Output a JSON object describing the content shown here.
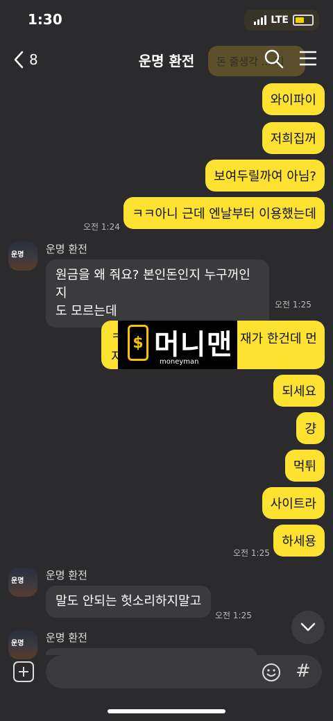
{
  "status_bar": {
    "time": "1:30",
    "network": "LTE"
  },
  "header": {
    "back_count": "8",
    "title": "운명 환전",
    "ghost_text": "돈 줄생각 ... 지"
  },
  "messages": {
    "m1": "와이파이",
    "m2": "저희집꺼",
    "m3": "보여두릴까여 아님?",
    "m4": "ㅋㅋ아니 근데 엔날부터 이용했는데",
    "m4_time": "오전 1:24",
    "o1_sender": "운명 환전",
    "o1_line1": "원금을 왜 줘요? 본인돈인지 누구꺼인지",
    "o1_line2": "도 모르는데",
    "o1_time": "오전 1:25",
    "m5_left": "ㅋ",
    "m5_left2": "지",
    "m5_right": "재가 한건데 먼",
    "m6": "되세요",
    "m7": "걍",
    "m8": "먹튀",
    "m9": "사이트라",
    "m10": "하세용",
    "m10_time": "오전 1:25",
    "o2_sender": "운명 환전",
    "o2_text": "말도 안되는 헛소리하지말고",
    "o2_time": "오전 1:25",
    "o3_sender": "운명 환전",
    "avatar_text": "운명"
  },
  "watermark": {
    "main": "머니맨",
    "sub": "moneyman",
    "symbol": "$"
  },
  "icons": {
    "back": "chevron-left-icon",
    "search": "search-icon",
    "menu": "menu-icon",
    "scroll": "chevron-down-icon",
    "plus": "plus-icon",
    "emoji": "emoji-icon",
    "hash": "#"
  },
  "colors": {
    "my_bubble": "#fde231",
    "other_bubble": "#3b3b3e",
    "background": "#2b2b2d"
  }
}
